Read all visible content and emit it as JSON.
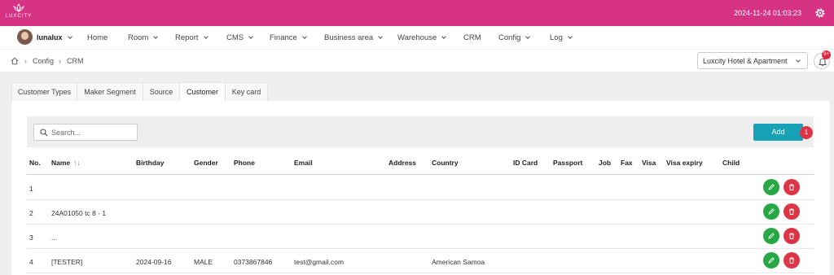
{
  "brand": {
    "logo_text": "LUXCITY"
  },
  "header": {
    "datetime": "2024-11-24 01:03:23"
  },
  "user": {
    "name": "lunalux"
  },
  "nav": {
    "items": [
      {
        "label": "Home",
        "has_dropdown": false
      },
      {
        "label": "Room",
        "has_dropdown": true
      },
      {
        "label": "Report",
        "has_dropdown": true
      },
      {
        "label": "CMS",
        "has_dropdown": true
      },
      {
        "label": "Finance",
        "has_dropdown": true
      },
      {
        "label": "Business area",
        "has_dropdown": true
      },
      {
        "label": "Warehouse",
        "has_dropdown": true
      },
      {
        "label": "CRM",
        "has_dropdown": false
      },
      {
        "label": "Config",
        "has_dropdown": true
      },
      {
        "label": "Log",
        "has_dropdown": true
      }
    ]
  },
  "breadcrumb": [
    "Config",
    "CRM"
  ],
  "hotel_select": {
    "value": "Luxcity Hotel & Apartment"
  },
  "notifications": {
    "count": "9+"
  },
  "tabs": [
    {
      "label": "Customer Types",
      "active": false
    },
    {
      "label": "Maker Segment",
      "active": false
    },
    {
      "label": "Source",
      "active": false
    },
    {
      "label": "Customer",
      "active": true
    },
    {
      "label": "Key card",
      "active": false
    }
  ],
  "toolbar": {
    "search_placeholder": "Search...",
    "add_label": "Add",
    "add_badge": "1"
  },
  "table": {
    "columns": [
      "No.",
      "Name",
      "Birthday",
      "Gender",
      "Phone",
      "Email",
      "Address",
      "Country",
      "ID Card",
      "Passport",
      "Job",
      "Fax",
      "Visa",
      "Visa expiry",
      "Child"
    ],
    "sort_icon": "↑↓",
    "rows": [
      {
        "no": "1",
        "name": "",
        "birthday": "",
        "gender": "",
        "phone": "",
        "email": "",
        "address": "",
        "country": ""
      },
      {
        "no": "2",
        "name": "24A01050 tc 8 - 1",
        "birthday": "",
        "gender": "",
        "phone": "",
        "email": "",
        "address": "",
        "country": ""
      },
      {
        "no": "3",
        "name": "...",
        "birthday": "",
        "gender": "",
        "phone": "",
        "email": "",
        "address": "",
        "country": ""
      },
      {
        "no": "4",
        "name": "[TESTER]",
        "birthday": "2024-09-16",
        "gender": "MALE",
        "phone": "0373867846",
        "email": "test@gmail.com",
        "address": "",
        "country": "American Samoa"
      }
    ]
  },
  "colors": {
    "topbar": "#d63384",
    "add_button": "#17a2b8",
    "edit_button": "#28a745",
    "delete_button": "#dc3545"
  }
}
